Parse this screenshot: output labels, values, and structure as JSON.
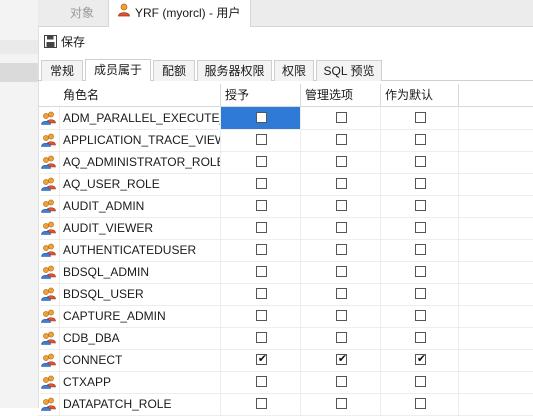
{
  "doc_tabs": {
    "objects_label": "对象",
    "active_label": "YRF (myorcl) - 用户"
  },
  "toolbar": {
    "save_label": "保存"
  },
  "sub_tabs": [
    {
      "label": "常规"
    },
    {
      "label": "成员属于"
    },
    {
      "label": "配额"
    },
    {
      "label": "服务器权限"
    },
    {
      "label": "权限"
    },
    {
      "label": "SQL 预览"
    }
  ],
  "grid": {
    "columns": [
      "角色名",
      "授予",
      "管理选项",
      "作为默认"
    ],
    "rows": [
      {
        "name": "ADM_PARALLEL_EXECUTE_TASK",
        "granted": false,
        "admin": false,
        "default": false
      },
      {
        "name": "APPLICATION_TRACE_VIEWER",
        "granted": false,
        "admin": false,
        "default": false
      },
      {
        "name": "AQ_ADMINISTRATOR_ROLE",
        "granted": false,
        "admin": false,
        "default": false
      },
      {
        "name": "AQ_USER_ROLE",
        "granted": false,
        "admin": false,
        "default": false
      },
      {
        "name": "AUDIT_ADMIN",
        "granted": false,
        "admin": false,
        "default": false
      },
      {
        "name": "AUDIT_VIEWER",
        "granted": false,
        "admin": false,
        "default": false
      },
      {
        "name": "AUTHENTICATEDUSER",
        "granted": false,
        "admin": false,
        "default": false
      },
      {
        "name": "BDSQL_ADMIN",
        "granted": false,
        "admin": false,
        "default": false
      },
      {
        "name": "BDSQL_USER",
        "granted": false,
        "admin": false,
        "default": false
      },
      {
        "name": "CAPTURE_ADMIN",
        "granted": false,
        "admin": false,
        "default": false
      },
      {
        "name": "CDB_DBA",
        "granted": false,
        "admin": false,
        "default": false
      },
      {
        "name": "CONNECT",
        "granted": true,
        "admin": true,
        "default": true
      },
      {
        "name": "CTXAPP",
        "granted": false,
        "admin": false,
        "default": false
      },
      {
        "name": "DATAPATCH_ROLE",
        "granted": false,
        "admin": false,
        "default": false
      }
    ]
  },
  "colors": {
    "selection": "#2f7ad6"
  }
}
